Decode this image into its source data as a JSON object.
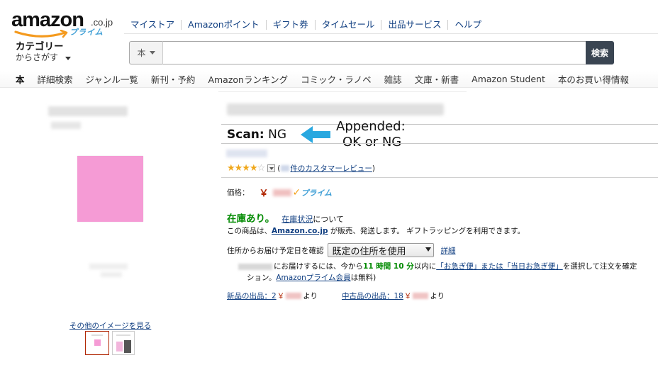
{
  "logo": {
    "word": "amazon",
    "tld": ".co.jp",
    "sub": "プライム"
  },
  "topnav": [
    "マイストア",
    "Amazonポイント",
    "ギフト券",
    "タイムセール",
    "出品サービス",
    "ヘルプ"
  ],
  "category": {
    "title": "カテゴリー",
    "subtitle": "からさがす"
  },
  "search": {
    "scope": "本",
    "value": "",
    "button": "検索"
  },
  "subnav": [
    "本",
    "詳細検索",
    "ジャンル一覧",
    "新刊・予約",
    "Amazonランキング",
    "コミック・ラノベ",
    "雑誌",
    "文庫・新書",
    "Amazon Student",
    "本のお買い得情報"
  ],
  "scan": {
    "label": "Scan:",
    "value": "NG"
  },
  "annotation": {
    "line1": "Appended:",
    "line2": "OK or NG"
  },
  "rating": {
    "stars": 3.5,
    "review_prefix": "(",
    "review_link": "件のカスタマーレビュー",
    "review_suffix": ")"
  },
  "price": {
    "label": "価格：",
    "currency": "￥",
    "prime_check": "✓",
    "prime": "プライム"
  },
  "stock": {
    "status": "在庫あり。",
    "link": "在庫状況",
    "after": "について"
  },
  "seller": {
    "prefix": "この商品は、",
    "link": "Amazon.co.jp",
    "suffix": " が販売、発送します。 ギフトラッピングを利用できます。"
  },
  "delivery": {
    "label": "住所からお届け予定日を確認",
    "selected": "既定の住所を使用",
    "detail": "詳細"
  },
  "order": {
    "t1": "にお届けするには、今から",
    "hours": "11 時間 10 分",
    "t2": "以内に",
    "link1": "「お急ぎ便」または「当日お急ぎ便」",
    "t3": "を選択して注文を確定",
    "t4": "ション。",
    "prime_link": "Amazonプライム会員",
    "t5": "は無料)"
  },
  "offers": {
    "new_link": "新品の出品：2",
    "used_link": "中古品の出品：18",
    "currency": "￥",
    "suffix": "より"
  },
  "more_images": "その他のイメージを見る",
  "colors": {
    "link": "#0e3d80",
    "price": "#b12704",
    "instock": "#008a00",
    "prime": "#3f9fd6",
    "annotation_arrow": "#29a8e0",
    "cover": "#f59bd5"
  }
}
